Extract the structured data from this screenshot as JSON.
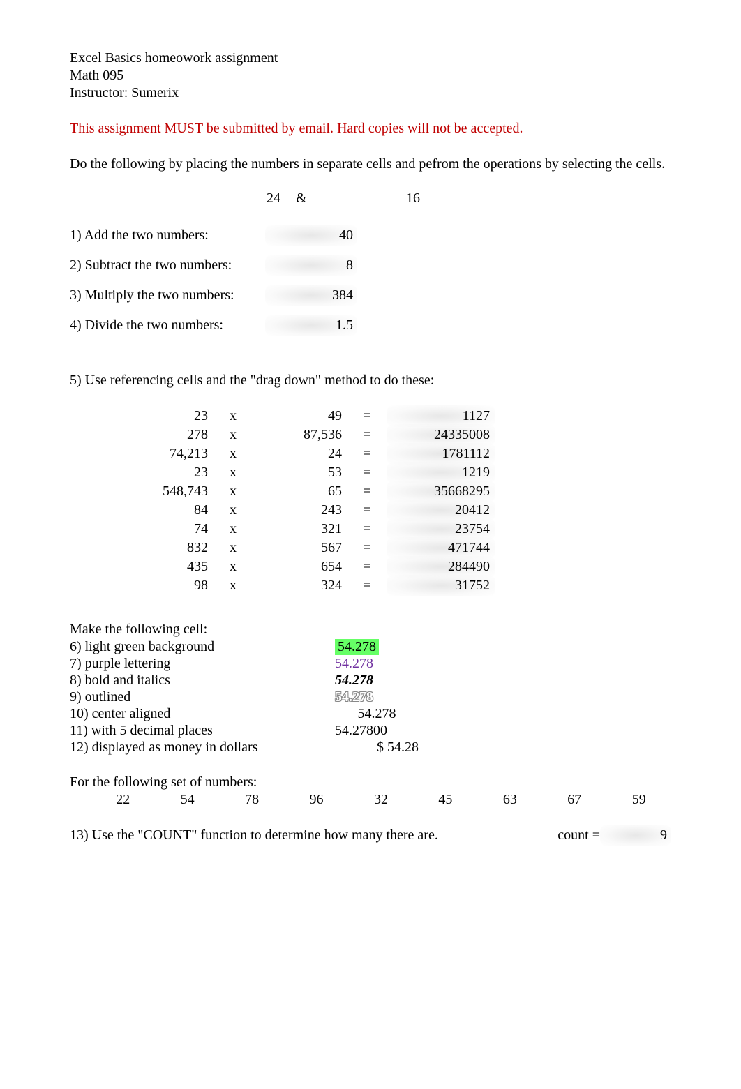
{
  "header": {
    "title": "Excel Basics homeowork assignment",
    "course": "Math 095",
    "instructor": "Instructor: Sumerix"
  },
  "warning": "This assignment MUST be submitted by email. Hard copies will not be accepted.",
  "intro": "Do the following by placing the numbers in separate cells and pefrom the operations by selecting the cells.",
  "inputs": {
    "a": "24",
    "amp": "&",
    "b": "16"
  },
  "ops": {
    "q1": {
      "label": "1) Add the two numbers:",
      "value": "40"
    },
    "q2": {
      "label": "2) Subtract the two numbers:",
      "value": "8"
    },
    "q3": {
      "label": "3) Multiply the two numbers:",
      "value": "384"
    },
    "q4": {
      "label": "4) Divide the two numbers:",
      "value": "1.5"
    }
  },
  "q5": {
    "label": "5) Use referencing cells and the \"drag down\" method to do these:",
    "rows": [
      {
        "a": "23",
        "x": "x",
        "b": "49",
        "eq": "=",
        "r": "1127"
      },
      {
        "a": "278",
        "x": "x",
        "b": "87,536",
        "eq": "=",
        "r": "24335008"
      },
      {
        "a": "74,213",
        "x": "x",
        "b": "24",
        "eq": "=",
        "r": "1781112"
      },
      {
        "a": "23",
        "x": "x",
        "b": "53",
        "eq": "=",
        "r": "1219"
      },
      {
        "a": "548,743",
        "x": "x",
        "b": "65",
        "eq": "=",
        "r": "35668295"
      },
      {
        "a": "84",
        "x": "x",
        "b": "243",
        "eq": "=",
        "r": "20412"
      },
      {
        "a": "74",
        "x": "x",
        "b": "321",
        "eq": "=",
        "r": "23754"
      },
      {
        "a": "832",
        "x": "x",
        "b": "567",
        "eq": "=",
        "r": "471744"
      },
      {
        "a": "435",
        "x": "x",
        "b": "654",
        "eq": "=",
        "r": "284490"
      },
      {
        "a": "98",
        "x": "x",
        "b": "324",
        "eq": "=",
        "r": "31752"
      }
    ]
  },
  "fmt": {
    "header": "Make the following cell:",
    "q6": {
      "label": "6) light green background",
      "value": "54.278"
    },
    "q7": {
      "label": "7) purple lettering",
      "value": "54.278"
    },
    "q8": {
      "label": "8) bold and italics",
      "value": "54.278"
    },
    "q9": {
      "label": "9) outlined",
      "value": "54.278"
    },
    "q10": {
      "label": "10) center aligned",
      "value": "54.278"
    },
    "q11": {
      "label": "11) with 5 decimal places",
      "value": "54.27800"
    },
    "q12": {
      "label": "12) displayed as money in dollars",
      "value": "$   54.28"
    }
  },
  "numset": {
    "label": "For the following set of numbers:",
    "values": [
      "22",
      "54",
      "78",
      "96",
      "32",
      "45",
      "63",
      "67",
      "59"
    ]
  },
  "q13": {
    "label": "13) Use the \"COUNT\" function to determine how many there are.",
    "count_label": "count =",
    "value": "9"
  }
}
